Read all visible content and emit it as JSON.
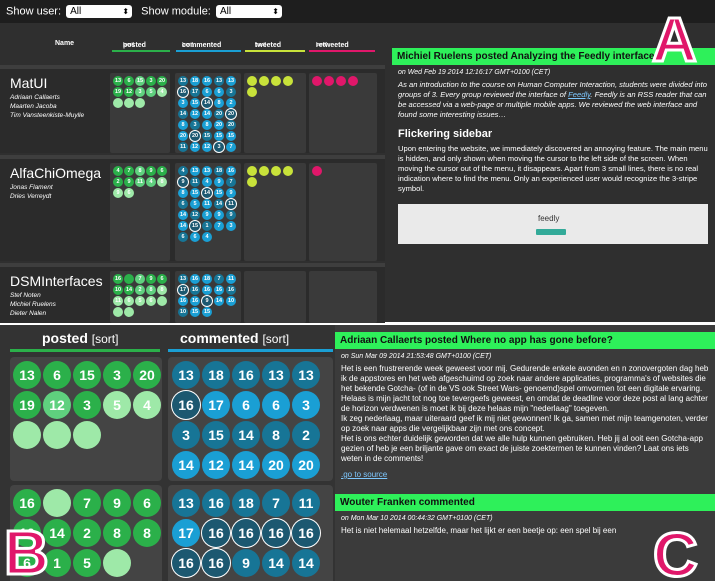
{
  "filters": {
    "show_user_label": "Show user:",
    "user_value": "All",
    "show_module_label": "Show module:",
    "module_value": "All"
  },
  "table": {
    "headers": {
      "name": "Name",
      "posted": "posted",
      "commented": "commented",
      "tweeted": "tweeted",
      "retweeted": "retweeted",
      "sort": "[sort]"
    },
    "groups": [
      {
        "name": "MatUI",
        "members": [
          "Adriaan Callaerts",
          "Maarten Jacoba",
          "Tim Vansteenkiste-Muylle"
        ],
        "posted": [
          "13",
          "6",
          "15",
          "3",
          "20",
          "19",
          "12",
          "3",
          "5",
          "4",
          "",
          "",
          ""
        ],
        "commented": [
          "13",
          "18",
          "16",
          "13",
          "13",
          "16",
          "17",
          "6",
          "6",
          "3",
          "3",
          "15",
          "14",
          "8",
          "2",
          "14",
          "12",
          "14",
          "20",
          "20",
          "8",
          "3",
          "8",
          "20",
          "20",
          "20",
          "20",
          "15",
          "15",
          "15",
          "11",
          "12",
          "12",
          "3",
          "7",
          "11",
          "16",
          "6",
          "6"
        ]
      },
      {
        "name": "AlfaChiOmega",
        "members": [
          "Jonas Flament",
          "Dries Verreydt"
        ],
        "posted": [
          "4",
          "7",
          "8",
          "9",
          "6",
          "2",
          "9",
          "11",
          "4",
          "8",
          "9",
          "6"
        ],
        "commented": [
          "4",
          "13",
          "13",
          "18",
          "16",
          "9",
          "11",
          "4",
          "9",
          "7",
          "8",
          "15",
          "14",
          "15",
          "9",
          "6",
          "5",
          "11",
          "14",
          "11",
          "14",
          "12",
          "9",
          "9",
          "9",
          "14",
          "15",
          "1",
          "7",
          "3",
          "6",
          "6",
          "4"
        ]
      },
      {
        "name": "DSMInterfaces",
        "members": [
          "Stef Noten",
          "Michiel Ruelens",
          "Dieter Nalen"
        ],
        "posted": [
          "16",
          "",
          "7",
          "9",
          "6",
          "10",
          "14",
          "2",
          "8",
          "8",
          "11",
          "6",
          "5",
          "6",
          "",
          "",
          ""
        ],
        "commented": [
          "13",
          "16",
          "18",
          "7",
          "11",
          "17",
          "16",
          "16",
          "16",
          "16",
          "16",
          "16",
          "9",
          "14",
          "10",
          "10",
          "15",
          "15"
        ]
      }
    ]
  },
  "post_a": {
    "title": "Michiel Ruelens posted Analyzing the Feedly interface",
    "date": "on Wed Feb 19 2014 12:16:17 GMT+0100 (CET)",
    "intro_1": "As an introduction to the course on Human Computer Interaction, students were divided into groups of 3. Every group reviewed the interface of",
    "intro_link": "Feedly",
    "intro_2": ". Feedly is an RSS reader that can be accessed via a web-page or multiple mobile apps. We reviewed the web interface and found some interesting issues…",
    "heading": "Flickering sidebar",
    "body": "Upon entering the website, we immediately discovered an annoying feature. The main menu is hidden, and only shown when moving the cursor to the left side of the screen. When moving the cursor out of the menu, it disappears. Apart from 3 small lines, there is no real indication where to find the menu. Only an experienced user would recognize the 3-stripe symbol.",
    "shot_title": "feedly"
  },
  "labels": {
    "a": "A",
    "b": "B",
    "c": "C"
  },
  "zoom_b": {
    "posted": "posted",
    "commented": "commented",
    "sort": "[sort]",
    "posted_rows": [
      [
        "13",
        "6",
        "15",
        "3",
        "20"
      ],
      [
        "19",
        "12",
        "3",
        "5",
        "4"
      ],
      [
        "",
        "",
        ""
      ]
    ],
    "posted_rows2": [
      [
        "16",
        "",
        "7",
        "9",
        "6"
      ],
      [
        "10",
        "14",
        "2",
        "8",
        "8"
      ],
      [
        "6",
        "1",
        "5",
        ""
      ]
    ],
    "commented_rows": [
      [
        "13",
        "18",
        "16",
        "13",
        "13"
      ],
      [
        "16",
        "17",
        "6",
        "6",
        "3"
      ],
      [
        "3",
        "15",
        "14",
        "8",
        "2"
      ],
      [
        "14",
        "12",
        "14",
        "20",
        "20"
      ]
    ],
    "commented_rows2": [
      [
        "13",
        "16",
        "18",
        "7",
        "11"
      ],
      [
        "17",
        "16",
        "16",
        "16",
        "16"
      ],
      [
        "16",
        "16",
        "9",
        "14",
        "14"
      ]
    ]
  },
  "post_c": {
    "title": "Adriaan Callaerts posted Where no app has gone before?",
    "date": "on Sun Mar 09 2014 21:53:48 GMT+0100 (CET)",
    "body": "Het is een frustrerende week geweest voor mij. Gedurende enkele avonden en n zonovergoten dag heb ik de appstores en het web afgeschuimd op zoek naar andere applicaties, programma's of websites die het bekende Gotcha- (of in de VS ook Street Wars- genoemd)spel omvormen tot een digitale ervaring. Helaas is mijn jacht tot nog toe tevergeefs geweest, en omdat de deadline voor deze post al lang achter de horizon verdwenen is moet ik bij deze helaas mijn \"nederlaag\" toegeven.\nIk zeg nederlaag, maar uiteraard geef ik mij niet gewonnen! Ik ga, samen met mijn teamgenoten, verder op zoek naar apps die vergelijkbaar zijn met ons concept.\nHet is ons echter duidelijk geworden dat we alle hulp kunnen gebruiken. Heb jij al ooit een Gotcha-app gezien of heb je een briljante gave om exact de juiste zoektermen te kunnen vinden? Laat ons iets weten in de comments!",
    "link": ".go to source",
    "comment_title": "Wouter Franken commented",
    "comment_date": "on Mon Mar 10 2014 00:44:32 GMT+0100 (CET)",
    "comment_body": "Het is niet helemaal hetzelfde, maar het lijkt er een beetje op: een spel bij een"
  },
  "colors": {
    "green": "#2ef05a",
    "pink": "#e0176a",
    "blue": "#1a9fd4",
    "yellow": "#c8e23a"
  }
}
